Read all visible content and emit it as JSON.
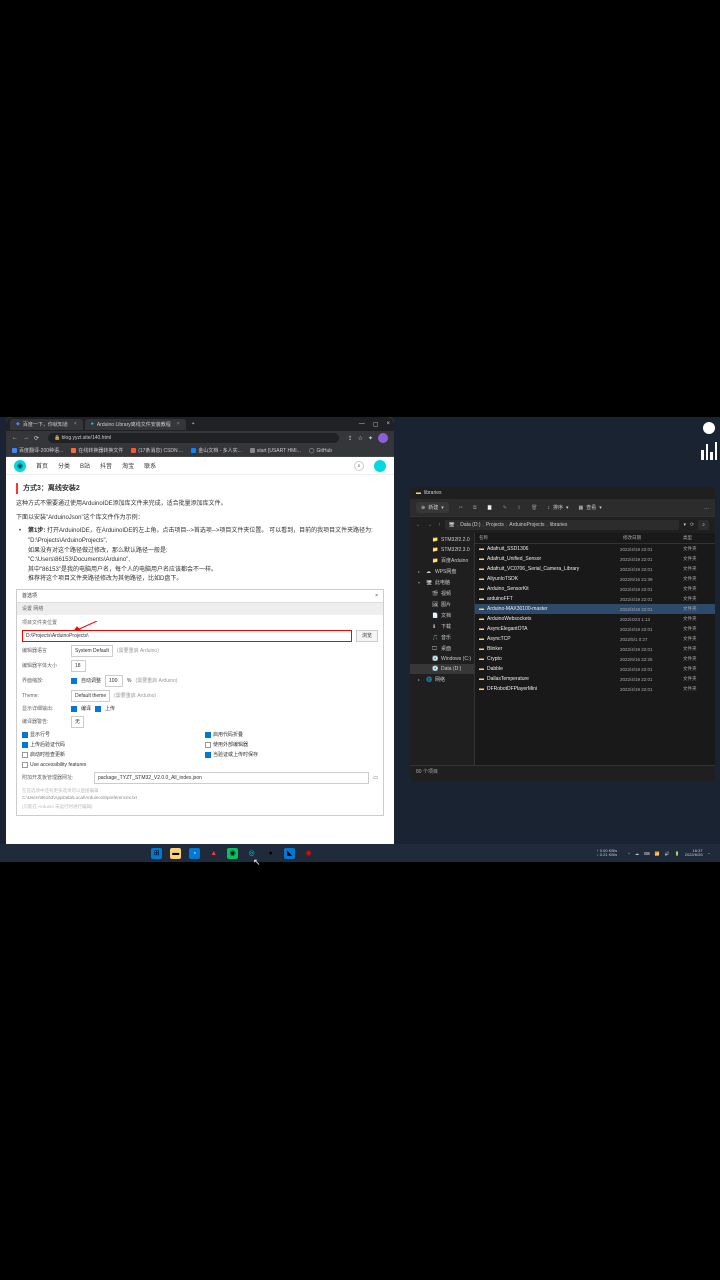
{
  "browser": {
    "tabs": [
      {
        "title": "百度一下，你就知道",
        "active": false
      },
      {
        "title": "Arduino Library离线文件安装教程",
        "active": true
      }
    ],
    "url": "blog.yyzt.site/140.html",
    "bookmarks": [
      {
        "label": "百度翻译-200种语...",
        "color": "#4285f4"
      },
      {
        "label": "在线转换器转换文件",
        "color": "#ff6b35"
      },
      {
        "label": "(17条消息) CSDN ...",
        "color": "#fc5531"
      },
      {
        "label": "金山文档 - 多人实...",
        "color": "#0a84ff"
      },
      {
        "label": "start [USART HMI...",
        "color": "#888"
      },
      {
        "label": "GitHub",
        "color": "#fff",
        "icon": "github"
      }
    ]
  },
  "page": {
    "nav": [
      "首页",
      "分类",
      "B站",
      "抖音",
      "淘宝",
      "联系"
    ],
    "section_title": "方式3：离线安装2",
    "para1": "这种方式不需要通过使用ArduinoIDE添加库文件来完成，适合批量添加库文件。",
    "para2": "下面以安装\"ArduinoJson\"这个库文件作为示例：",
    "step_label": "第1步:",
    "step_text": "打开ArduinoIDE，在ArduinoIDE的左上角，点击项目-->首选项-->项目文件夹位置。",
    "step_line2": "可以看到，目前的我项目文件夹路径为:",
    "path1": "\"D:\\Projects\\ArduinoProjects\",",
    "line3": "如果没有对这个路径做过修改，那么默认路径一般是:",
    "path2": "\"C:\\Users\\86153\\Documents\\Arduino\",",
    "line4": "其中\"86153\"是我的电脑用户名，每个人的电脑用户名应该都会不一样。",
    "line5": "推荐将这个项目文件夹路径修改为其他路径，比如D盘下。"
  },
  "dialog": {
    "title": "首选项",
    "close": "×",
    "tabs": "设置  网络",
    "sketchbook_label": "项目文件夹位置",
    "sketchbook_path": "D:\\Projects\\ArduinoProjects\\",
    "browse_btn": "浏览",
    "editor_lang_label": "编辑器语言",
    "editor_lang_value": "System Default",
    "restart_note": "(需要重启 Arduino)",
    "font_label": "编辑器字体大小",
    "font_value": "18",
    "scale_label": "界面缩放:",
    "scale_auto": "自动调整",
    "scale_value": "100",
    "scale_pct": "%",
    "theme_label": "Theme:",
    "theme_value": "Default theme",
    "verbose_label": "显示详细输出:",
    "verbose_compile": "编译",
    "verbose_upload": "上传",
    "warn_label": "编译器警告:",
    "warn_value": "无",
    "checks": {
      "line_numbers": "显示行号",
      "code_folding": "启用代码折叠",
      "verify_upload": "上传后验证代码",
      "external_editor": "使用外部编辑器",
      "check_update": "启动时检查更新",
      "save_verify": "当验证或上传时保存",
      "accessibility": "Use accessibility features"
    },
    "board_url_label": "附加开发板管理器网址:",
    "board_url_value": "package_TYZT_STM32_V2.0.0_All_index.json",
    "deep_pref": "在首选项中还有更多选项可以直接编辑",
    "deep_path": "C:\\Users\\86153\\AppData\\Local\\Arduino15\\preferences.txt",
    "deep_note": "(只能在 Arduino 未运行时进行编辑)"
  },
  "explorer": {
    "title": "libraries",
    "new_btn": "新建",
    "sort": "排序",
    "view": "查看",
    "breadcrumb": [
      "Data (D:)",
      "Projects",
      "ArduinoProjects",
      "libraries"
    ],
    "sidebar": [
      {
        "label": "STM32f2.2.0",
        "icon": "folder",
        "indent": 1
      },
      {
        "label": "STM32f2.3.0",
        "icon": "folder",
        "indent": 1
      },
      {
        "label": "百度Arduino",
        "icon": "folder",
        "indent": 1
      },
      {
        "label": "WPS网盘",
        "icon": "wps",
        "indent": 0,
        "arrow": true
      },
      {
        "label": "此电脑",
        "icon": "pc",
        "indent": 0,
        "arrow": true,
        "open": true
      },
      {
        "label": "视频",
        "icon": "video",
        "indent": 1
      },
      {
        "label": "图片",
        "icon": "image",
        "indent": 1
      },
      {
        "label": "文档",
        "icon": "doc",
        "indent": 1
      },
      {
        "label": "下载",
        "icon": "dl",
        "indent": 1
      },
      {
        "label": "音乐",
        "icon": "music",
        "indent": 1
      },
      {
        "label": "桌面",
        "icon": "desk",
        "indent": 1
      },
      {
        "label": "Windows (C:)",
        "icon": "disk",
        "indent": 1
      },
      {
        "label": "Data (D:)",
        "icon": "disk",
        "indent": 1,
        "selected": true
      },
      {
        "label": "网络",
        "icon": "net",
        "indent": 0,
        "arrow": true
      }
    ],
    "columns": {
      "name": "名称",
      "date": "修改日期",
      "type": "类型"
    },
    "rows": [
      {
        "name": "Adafruit_SSD1306",
        "date": "2022/4/19 22:01",
        "type": "文件夹"
      },
      {
        "name": "Adafruit_Unified_Sensor",
        "date": "2022/4/19 22:01",
        "type": "文件夹"
      },
      {
        "name": "Adafruit_VC0706_Serial_Camera_Library",
        "date": "2022/4/19 22:01",
        "type": "文件夹"
      },
      {
        "name": "AliyunIoTSDK",
        "date": "2022/6/16 21:39",
        "type": "文件夹"
      },
      {
        "name": "Arduino_SensorKit",
        "date": "2022/4/19 22:01",
        "type": "文件夹"
      },
      {
        "name": "arduinoFFT",
        "date": "2022/4/19 22:01",
        "type": "文件夹"
      },
      {
        "name": "Arduino-MAX30100-master",
        "date": "2022/4/19 22:01",
        "type": "文件夹",
        "selected": true
      },
      {
        "name": "ArduinoWebsockets",
        "date": "2022/4/23 1:13",
        "type": "文件夹"
      },
      {
        "name": "AsyncElegantOTA",
        "date": "2022/4/19 22:01",
        "type": "文件夹"
      },
      {
        "name": "AsyncTCP",
        "date": "2022/5/1 0:27",
        "type": "文件夹"
      },
      {
        "name": "Blinker",
        "date": "2022/4/19 22:01",
        "type": "文件夹"
      },
      {
        "name": "Crypto",
        "date": "2022/6/16 22:25",
        "type": "文件夹"
      },
      {
        "name": "Dabble",
        "date": "2022/4/19 22:01",
        "type": "文件夹"
      },
      {
        "name": "DallasTemperature",
        "date": "2022/4/19 22:01",
        "type": "文件夹"
      },
      {
        "name": "DFRobotDFPlayerMini",
        "date": "2022/4/19 22:01",
        "type": "文件夹"
      }
    ],
    "status": "80 个项目"
  },
  "taskbar": {
    "net_up": "0.00 KB/s",
    "net_dn": "0.21 KB/s",
    "time": "16:37",
    "date": "2022/6/26"
  }
}
